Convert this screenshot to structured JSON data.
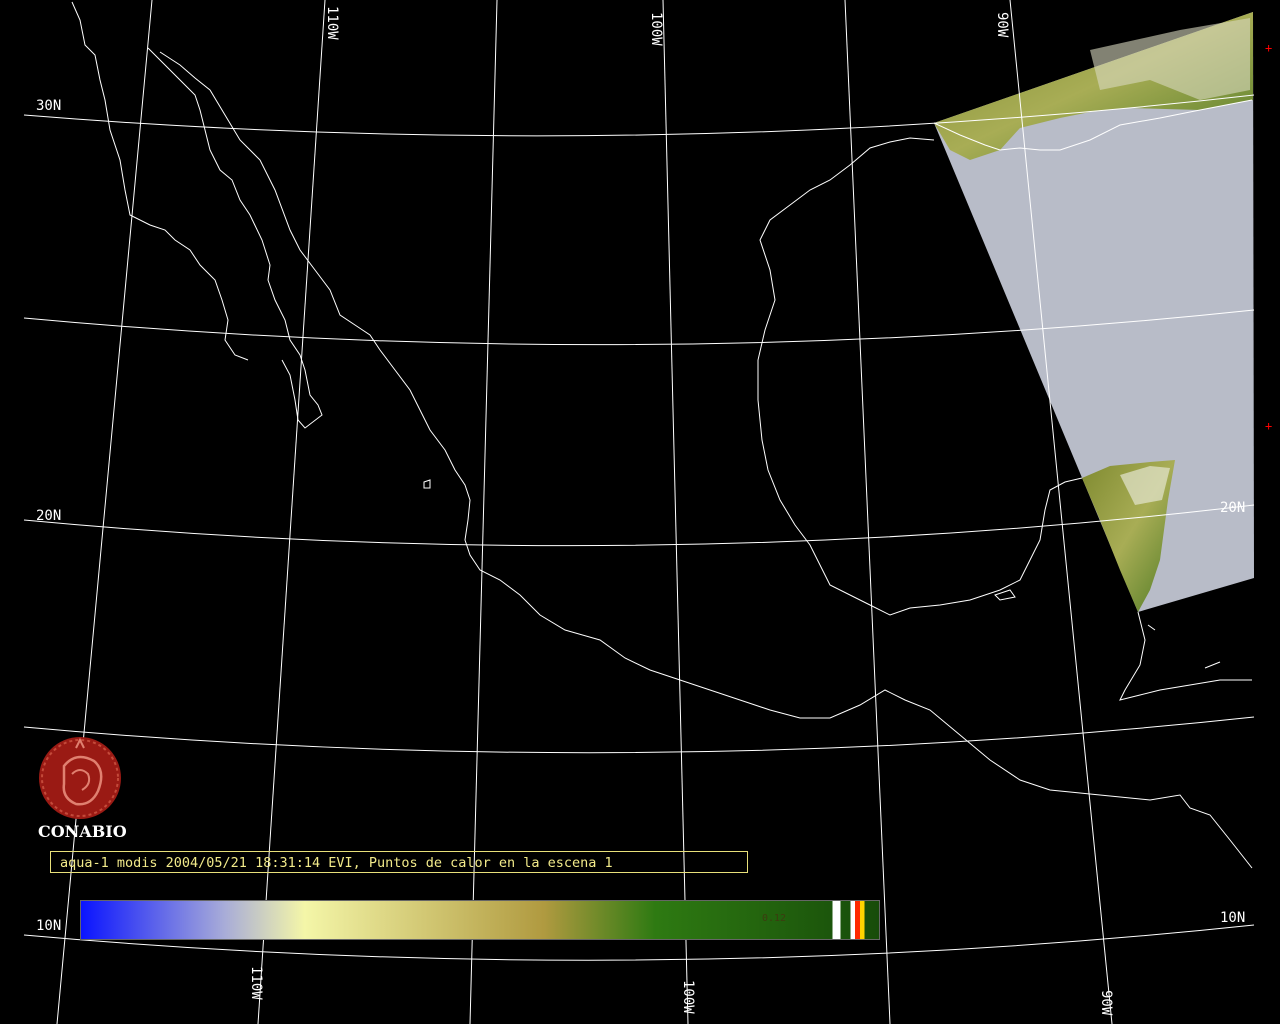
{
  "grid_labels": {
    "lon_top": [
      "110W",
      "100W",
      "90W"
    ],
    "lon_bottom": [
      "110W",
      "100W",
      "90W"
    ],
    "lat_left": [
      "30N",
      "20N",
      "10N"
    ],
    "lat_right": [
      "20N",
      "10N"
    ]
  },
  "logo": {
    "name": "CONABIO"
  },
  "caption": "aqua-1 modis 2004/05/21 18:31:14 EVI, Puntos de calor en la escena 1",
  "colorbar": {
    "tick_label": "0.12",
    "colors": [
      "#0a14ff",
      "#a8acd8",
      "#f4f6a8",
      "#b09a40",
      "#2e7a12",
      "#174c0a"
    ]
  },
  "markers": {
    "symbol": "+",
    "color": "#ff0000"
  },
  "colors": {
    "background": "#000000",
    "coastline": "#ffffff",
    "graticule": "#ffffff",
    "caption_text": "#f2ea8a",
    "logo": "#9a1a14"
  }
}
